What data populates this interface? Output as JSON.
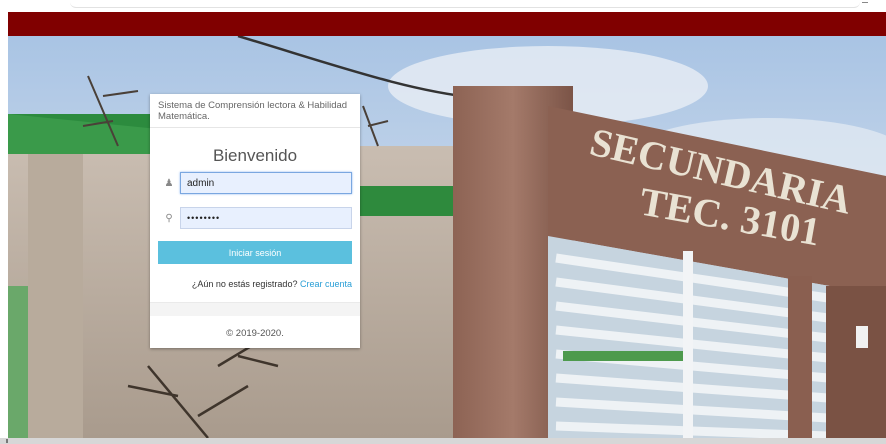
{
  "banner_color": "#800000",
  "login": {
    "system_title": "Sistema de Comprensión lectora & Habilidad Matemática.",
    "welcome": "Bienvenido",
    "username_value": "admin",
    "password_value": "••••••••",
    "user_icon": "user-icon",
    "password_icon": "key-icon",
    "submit_label": "Iniciar sesión",
    "register_prompt": "¿Aún no estás registrado?",
    "register_link": "Crear cuenta",
    "footer": "© 2019-2020."
  },
  "background": {
    "sign_line1": "SECUNDARIA",
    "sign_line2": "TEC. 3101"
  }
}
